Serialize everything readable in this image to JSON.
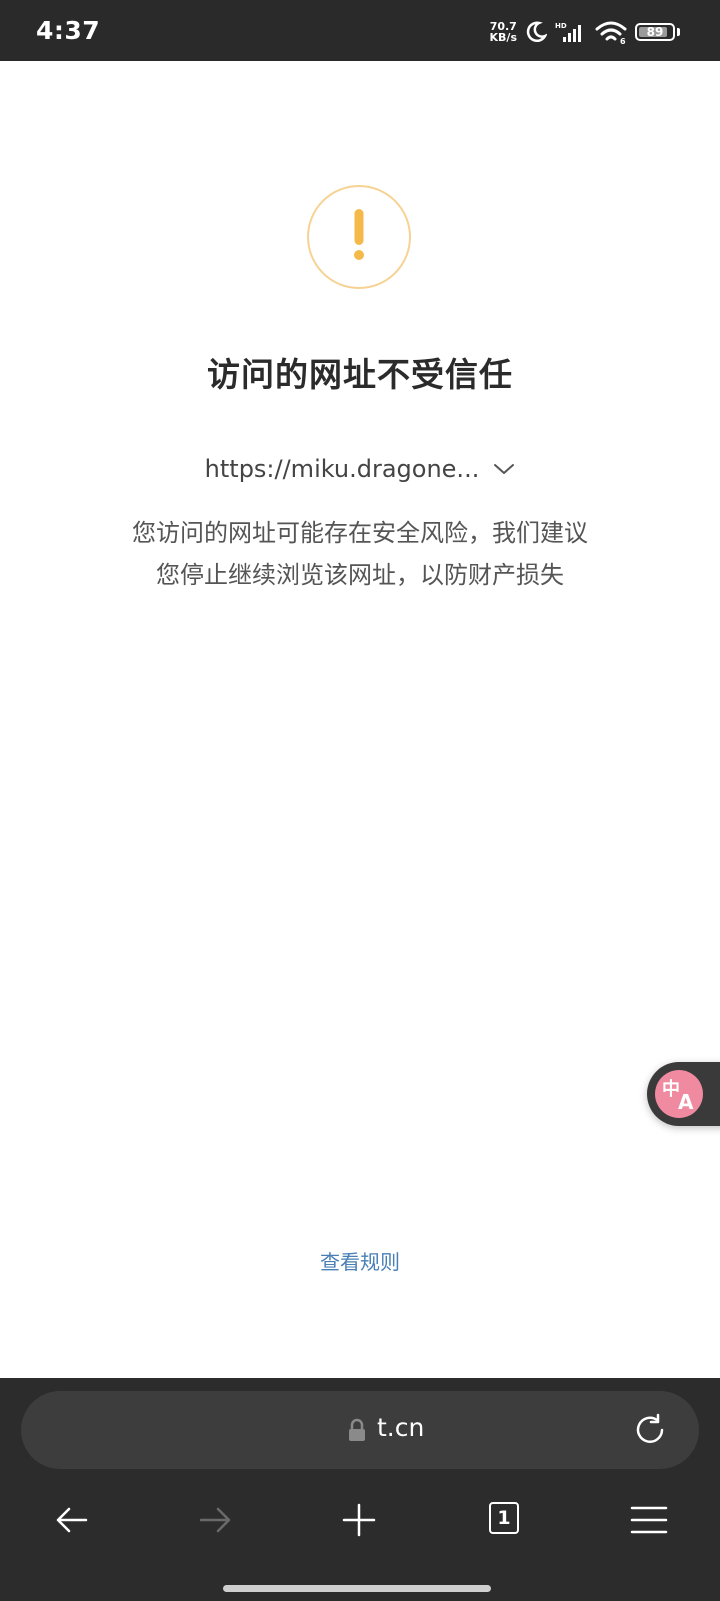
{
  "status_bar": {
    "time": "4:37",
    "net_speed_value": "70.7",
    "net_speed_unit": "KB/s",
    "battery_level": "89"
  },
  "warning": {
    "icon": "exclamation-icon",
    "title": "访问的网址不受信任",
    "url": "https://miku.dragone...",
    "description_line1": "您访问的网址可能存在安全风险，我们建议",
    "description_line2": "您停止继续浏览该网址，以防财产损失",
    "rules_link": "查看规则"
  },
  "translate_button": {
    "label_zh": "中",
    "label_a": "A"
  },
  "browser_bar": {
    "address": "t.cn",
    "tab_count": "1"
  },
  "colors": {
    "warning_accent": "#f5b94a",
    "link_blue": "#4a7fb5",
    "chrome_dark": "#2c2c2c",
    "translate_pink": "#ef8aa0"
  }
}
